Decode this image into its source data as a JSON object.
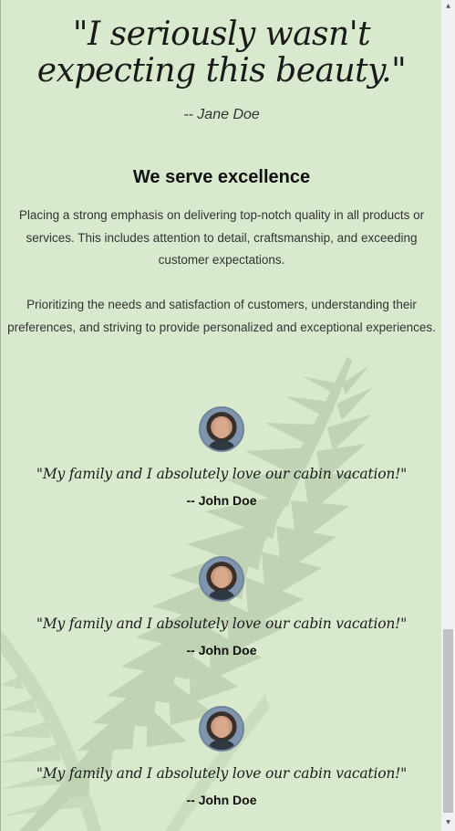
{
  "hero": {
    "quote_line1": "\"I seriously wasn't",
    "quote_line2": "expecting this beauty.\"",
    "author": "-- Jane Doe"
  },
  "section": {
    "title": "We serve excellence",
    "paragraph1": "Placing a strong emphasis on delivering top-notch quality in all products or services. This includes attention to detail, craftsmanship, and exceeding customer expectations.",
    "paragraph2": "Prioritizing the needs and satisfaction of customers, understanding their preferences, and striving to provide personalized and exceptional experiences."
  },
  "testimonials": [
    {
      "quote": "\"My family and I absolutely love our cabin vacation!\"",
      "author": "-- John Doe",
      "avatar_icon": "person-avatar"
    },
    {
      "quote": "\"My family and I absolutely love our cabin vacation!\"",
      "author": "-- John Doe",
      "avatar_icon": "person-avatar"
    },
    {
      "quote": "\"My family and I absolutely love our cabin vacation!\"",
      "author": "-- John Doe",
      "avatar_icon": "person-avatar"
    }
  ],
  "colors": {
    "background": "#d9e9cd",
    "fern": "#b9cfae",
    "text": "#222222"
  }
}
